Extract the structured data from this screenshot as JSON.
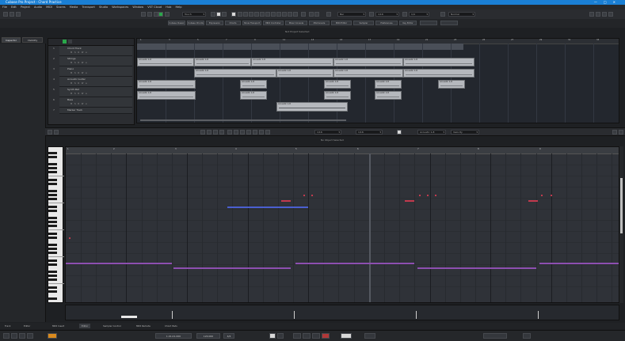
{
  "window": {
    "title": "Cubase Pro Project - Chord Practice",
    "controls": [
      "—",
      "□",
      "✕"
    ]
  },
  "menu": [
    "File",
    "Edit",
    "Project",
    "Audio",
    "MIDI",
    "Scores",
    "Media",
    "Transport",
    "Studio",
    "Workspaces",
    "Window",
    "VST Cloud",
    "Hub",
    "Help"
  ],
  "toolbar": {
    "mode_field": "Touch",
    "grid_field": "Bar",
    "quantize_field": "1/16",
    "snap_field": "1/4",
    "record_field": "Normal"
  },
  "toolbar2": [
    "Cubase Classic",
    "Cubase Chords",
    "Expression",
    "Chords",
    "Show Transport",
    "MIDI Controller",
    "Mixer Console",
    "MixConsole",
    "MIDI Editor",
    "Sampler",
    "Preferences",
    "Key Editor"
  ],
  "left_tabs": [
    "Inspector",
    "Visibility"
  ],
  "project_label": "Not Project Selected",
  "tracks": [
    {
      "num": "1",
      "name": "Chord Track"
    },
    {
      "num": "2",
      "name": "Strings"
    },
    {
      "num": "3",
      "name": "Piano"
    },
    {
      "num": "4",
      "name": "Acoustic Guitar"
    },
    {
      "num": "5",
      "name": "Synth Pad"
    },
    {
      "num": "6",
      "name": "Bass"
    },
    {
      "num": "7",
      "name": "Marker Track"
    }
  ],
  "track_buttons": "M S R W e",
  "arrange_ruler": [
    "1",
    "3",
    "5",
    "7",
    "9",
    "11",
    "13",
    "15",
    "17",
    "19",
    "21",
    "23",
    "25",
    "27",
    "29",
    "31",
    "33"
  ],
  "parts": [
    {
      "label": "Acoustic 1-8"
    },
    {
      "label": "Acoustic 1-8"
    },
    {
      "label": "Acoustic 1-8"
    },
    {
      "label": "Acoustic 1-8"
    },
    {
      "label": "Acoustic 1-8"
    },
    {
      "label": "Acoustic 1-8"
    },
    {
      "label": "Acoustic 1-8"
    },
    {
      "label": "Acoustic 1-8"
    },
    {
      "label": "Acoustic 1-8"
    },
    {
      "label": "Acoustic 1-8"
    },
    {
      "label": "Acoustic 1-8"
    },
    {
      "label": "Acoustic 1-8"
    },
    {
      "label": "Acoustic 1-8"
    },
    {
      "label": "Acoustic 1-8"
    },
    {
      "label": "Acoustic 1-8"
    },
    {
      "label": "Acoustic 1-8"
    },
    {
      "label": "Acoustic 1-8"
    },
    {
      "label": "Acoustic 1-8"
    }
  ],
  "editor": {
    "title": "No Object Selected",
    "field1": "1/16",
    "field2": "1/16",
    "field3": "Acoustic 1-8",
    "field4": "Velocity"
  },
  "proll_ruler": [
    "1",
    "2",
    "3",
    "4",
    "5",
    "6",
    "7",
    "8",
    "9"
  ],
  "bottom_tabs": [
    "Track",
    "Editor",
    "MIDI Insert",
    "Editor",
    "Sampler Control",
    "MIDI Remote",
    "Chord Pads"
  ],
  "transport": {
    "position": "1.01.01.000",
    "tempo": "120.000",
    "signature": "4/4"
  },
  "colors": {
    "accent": "#1a7fd4",
    "note_red": "#c23a4e",
    "note_purple": "#8d4fb0",
    "note_blue": "#4a5fd0",
    "part_bg": "#b5b8bd"
  }
}
